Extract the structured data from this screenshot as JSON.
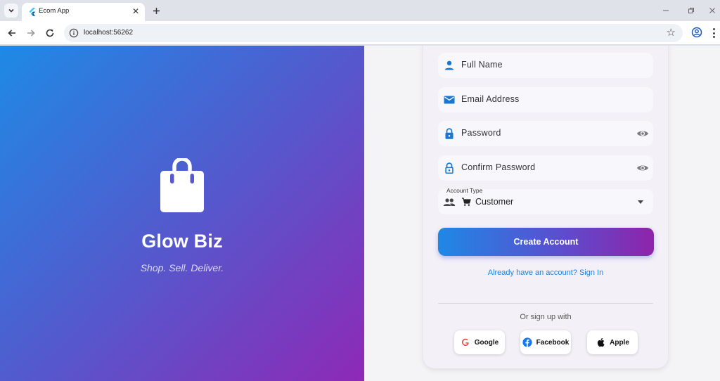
{
  "browser": {
    "tab_title": "Ecom App",
    "url": "localhost:56262"
  },
  "brand": {
    "name": "Glow Biz",
    "tagline": "Shop. Sell. Deliver.",
    "logo_icon": "shopping-bag-icon"
  },
  "form": {
    "fields": [
      {
        "label": "Full Name",
        "icon": "person-icon"
      },
      {
        "label": "Email Address",
        "icon": "email-icon"
      },
      {
        "label": "Password",
        "icon": "lock-icon",
        "toggle_icon": "visibility-icon"
      },
      {
        "label": "Confirm Password",
        "icon": "lock-outline-icon",
        "toggle_icon": "visibility-icon"
      }
    ],
    "account_type": {
      "label": "Account Type",
      "value": "Customer",
      "icon": "people-icon",
      "value_icon": "cart-icon"
    },
    "create_button": "Create Account",
    "signin_link": "Already have an account? Sign In",
    "divider_text": "Or sign up with",
    "social": [
      {
        "label": "Google",
        "icon": "google-icon"
      },
      {
        "label": "Facebook",
        "icon": "facebook-icon"
      },
      {
        "label": "Apple",
        "icon": "apple-icon"
      }
    ]
  },
  "colors": {
    "gradient_start": "#1e8ae5",
    "gradient_end": "#8e29b6",
    "field_icon": "#1976d2",
    "link": "#1e7fd6"
  }
}
